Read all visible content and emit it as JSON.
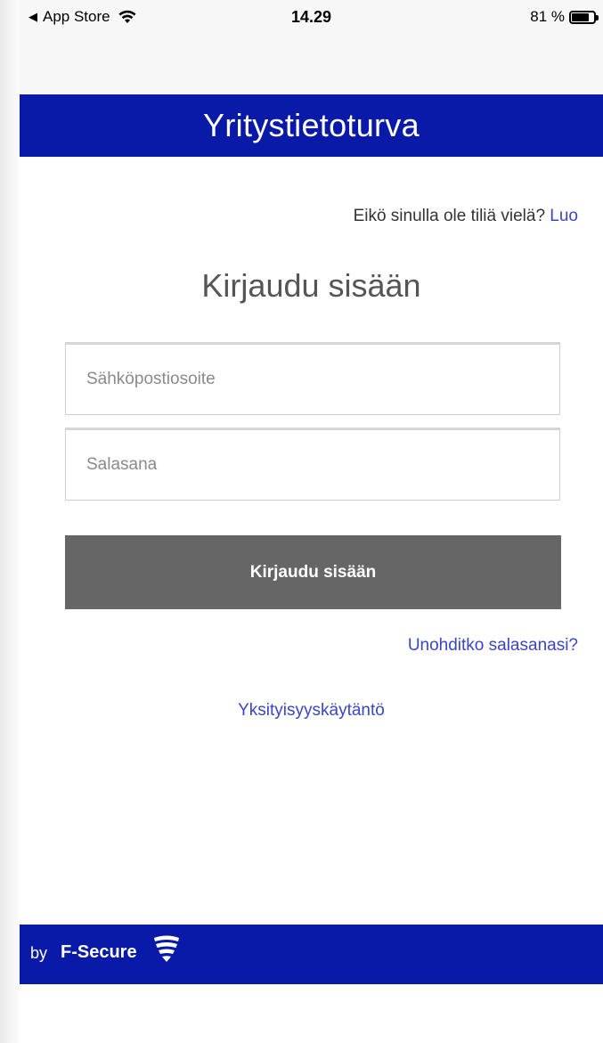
{
  "status_bar": {
    "back_label": "App Store",
    "back_icon": "back-triangle-icon",
    "wifi_icon": "wifi-icon",
    "time": "14.29",
    "battery_percent": "81 %",
    "battery_level": 0.81
  },
  "header": {
    "title": "Yritystietoturva",
    "background_color": "#0a1aa8"
  },
  "signup": {
    "prompt": "Eikö sinulla ole tiliä vielä?",
    "link_label": "Luo"
  },
  "login": {
    "heading": "Kirjaudu sisään",
    "email_placeholder": "Sähköpostiosoite",
    "email_value": "",
    "password_placeholder": "Salasana",
    "password_value": "",
    "submit_label": "Kirjaudu sisään",
    "forgot_label": "Unohditko salasanasi?",
    "privacy_label": "Yksityisyyskäytäntö"
  },
  "footer": {
    "by": "by",
    "brand": "F-Secure",
    "brand_icon": "f-secure-logo-icon"
  },
  "colors": {
    "brand_blue": "#0a1aa8",
    "link": "#3a45c8",
    "button": "#666666"
  }
}
